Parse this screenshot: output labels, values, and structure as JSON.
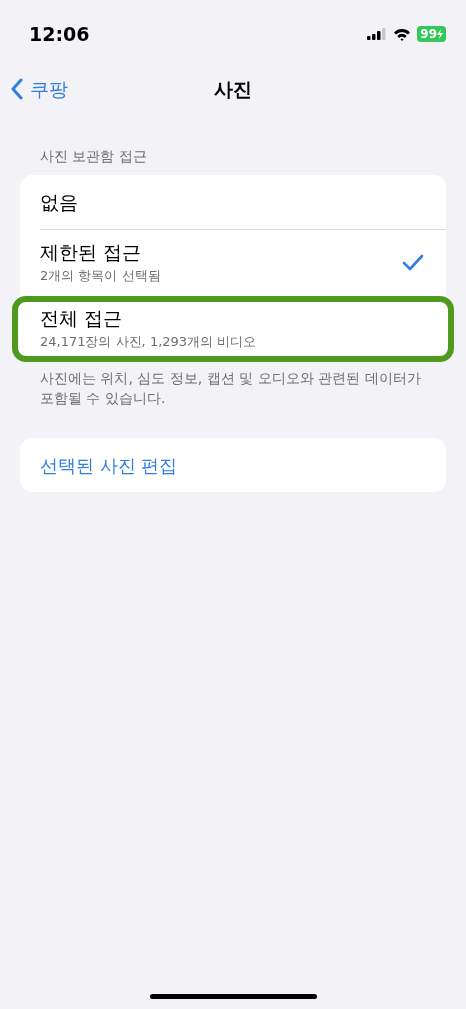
{
  "status_bar": {
    "time": "12:06",
    "battery": "99"
  },
  "nav": {
    "back": "쿠팡",
    "title": "사진"
  },
  "section": {
    "header": "사진 보관함 접근",
    "options": [
      {
        "label": "없음",
        "selected": false,
        "highlighted": false
      },
      {
        "label": "제한된 접근",
        "detail": "2개의 항목이 선택됨",
        "selected": true,
        "highlighted": false
      },
      {
        "label": "전체 접근",
        "detail": "24,171장의 사진, 1,293개의 비디오",
        "selected": false,
        "highlighted": true
      }
    ],
    "footer": "사진에는 위치, 심도 정보, 캡션 및 오디오와 관련된 데이터가 포함될 수 있습니다."
  },
  "action": "선택된 사진 편집"
}
